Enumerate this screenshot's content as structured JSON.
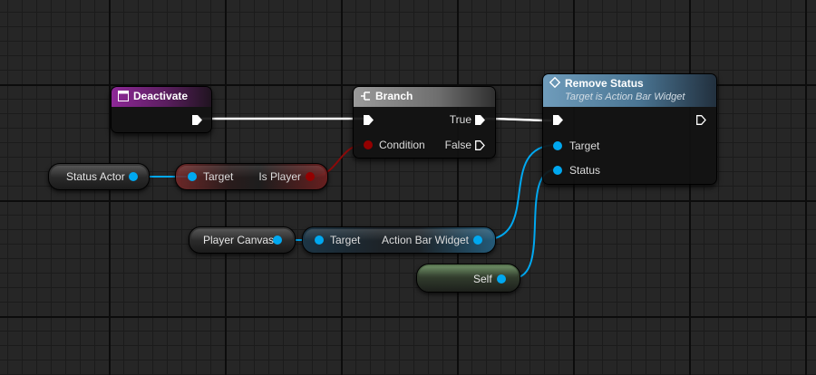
{
  "nodes": {
    "deactivate": {
      "title": "Deactivate"
    },
    "branch": {
      "title": "Branch",
      "true_label": "True",
      "false_label": "False",
      "condition_label": "Condition"
    },
    "remove_status": {
      "title": "Remove Status",
      "subtitle": "Target is Action Bar Widget",
      "target_label": "Target",
      "status_label": "Status"
    },
    "status_actor": {
      "label": "Status Actor"
    },
    "is_player": {
      "target_label": "Target",
      "output_label": "Is Player"
    },
    "player_canvas": {
      "label": "Player Canvas"
    },
    "action_bar_widget": {
      "target_label": "Target",
      "output_label": "Action Bar Widget"
    },
    "self": {
      "label": "Self"
    }
  },
  "colors": {
    "exec": "#ffffff",
    "object_pin": "#00a8f0",
    "bool_pin": "#940000",
    "event_header": "#7a1a84",
    "function_header": "#5b8aa8",
    "branch_header": "#8a8a8a"
  },
  "icons": {
    "event": "event-node-icon",
    "branch": "branch-icon",
    "function": "function-diamond-icon",
    "exec_pin": "exec-arrow-icon"
  }
}
